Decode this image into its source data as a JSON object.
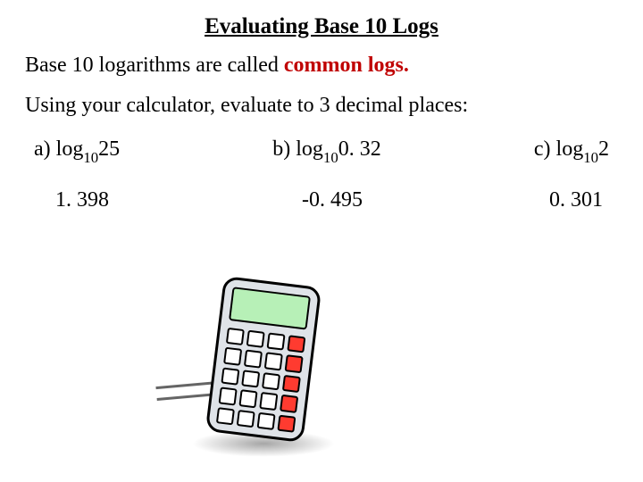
{
  "title": "Evaluating Base 10 Logs",
  "line1_prefix": "Base 10 logarithms are called ",
  "line1_emph": "common logs.",
  "line2": "Using your calculator, evaluate to 3 decimal places:",
  "problems": {
    "a": {
      "label": "a)  log",
      "base": "10",
      "arg": "25",
      "answer": "1. 398"
    },
    "b": {
      "label": "b)  log",
      "base": "10",
      "arg": "0. 32",
      "answer": "-0. 495"
    },
    "c": {
      "label": "c)  log",
      "base": "10",
      "arg": "2",
      "answer": "0. 301"
    }
  }
}
